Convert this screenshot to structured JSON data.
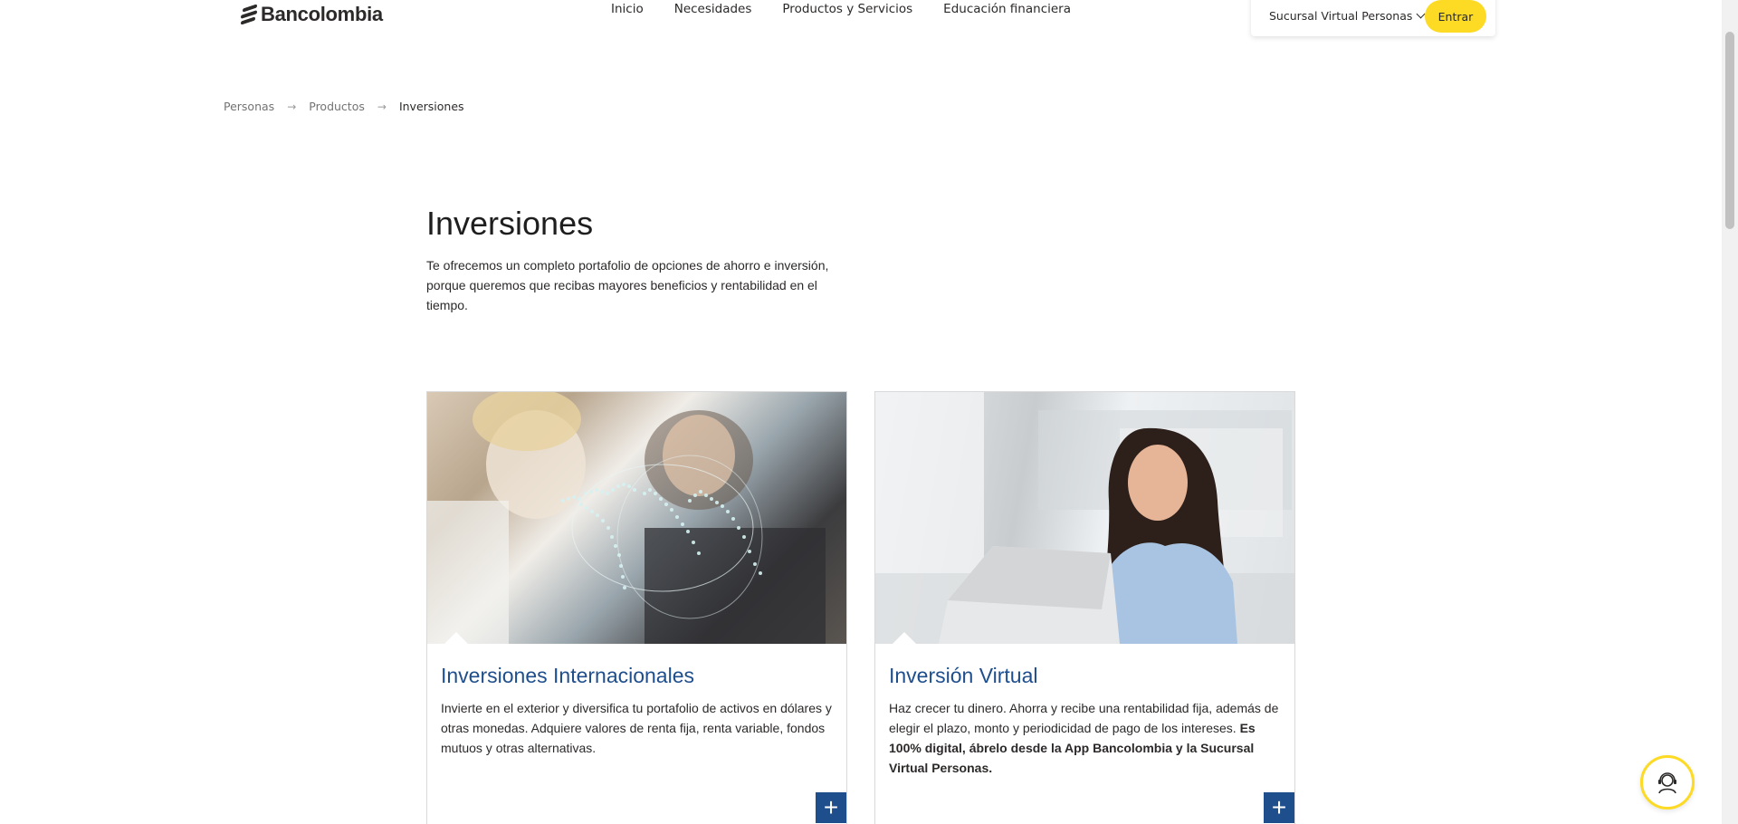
{
  "brand": {
    "name": "Bancolombia"
  },
  "nav": {
    "items": [
      {
        "label": "Inicio"
      },
      {
        "label": "Necesidades"
      },
      {
        "label": "Productos y Servicios"
      },
      {
        "label": "Educación financiera"
      }
    ]
  },
  "login": {
    "select_label": "Sucursal Virtual Personas",
    "button_label": "Entrar"
  },
  "breadcrumb": {
    "items": [
      {
        "label": "Personas"
      },
      {
        "label": "Productos"
      },
      {
        "label": "Inversiones"
      }
    ]
  },
  "main": {
    "title": "Inversiones",
    "description": "Te ofrecemos un completo portafolio de opciones de ahorro e inversión, porque queremos que recibas mayores beneficios y rentabilidad en el tiempo."
  },
  "cards": [
    {
      "title": "Inversiones Internacionales",
      "text": "Invierte en el exterior y diversifica tu portafolio de activos en dólares y otras monedas. Adquiere valores de renta fija, renta variable, fondos mutuos  y otras alternativas.",
      "image_icon": "world-map-photo",
      "plus_icon": "plus-icon"
    },
    {
      "title": "Inversión Virtual",
      "text": "Haz crecer tu dinero. Ahorra y recibe una rentabilidad fija, además de elegir el plazo, monto y periodicidad de pago de los intereses. ",
      "text_bold": "Es 100% digital, ábrelo desde la App Bancolombia y la Sucursal Virtual Personas.",
      "image_icon": "woman-laptop-photo",
      "plus_icon": "plus-icon"
    }
  ],
  "colors": {
    "accent": "#fdda24",
    "primary_blue": "#1f4e8c",
    "text": "#2c2a29"
  }
}
